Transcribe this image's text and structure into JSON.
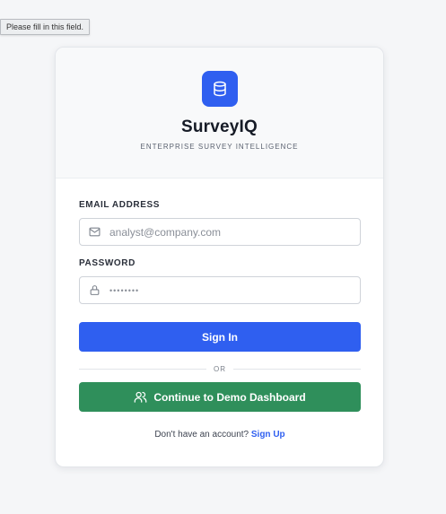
{
  "tooltip": {
    "text": "Please fill in this field."
  },
  "header": {
    "app_name": "SurveyIQ",
    "tagline": "ENTERPRISE SURVEY INTELLIGENCE",
    "logo_icon": "database-icon",
    "brand_color": "#2f5ff0"
  },
  "form": {
    "email": {
      "label": "EMAIL ADDRESS",
      "placeholder": "analyst@company.com",
      "value": "",
      "icon": "mail-icon"
    },
    "password": {
      "label": "PASSWORD",
      "placeholder": "••••••••",
      "value": "",
      "icon": "lock-icon"
    },
    "signin_label": "Sign In",
    "divider_text": "OR",
    "demo_label": "Continue to Demo Dashboard",
    "demo_icon": "users-icon",
    "demo_color": "#2f8f5b",
    "signup_prompt": "Don't have an account?",
    "signup_link": "Sign Up"
  }
}
